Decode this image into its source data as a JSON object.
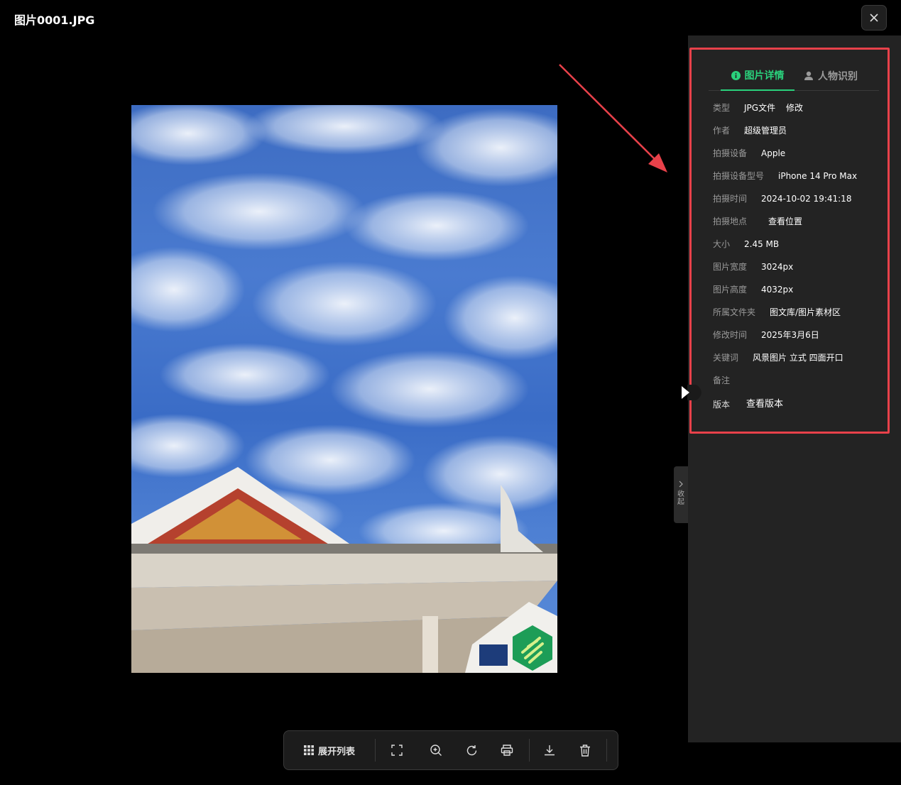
{
  "window": {
    "title": "图片0001.JPG"
  },
  "tabs": [
    {
      "label": "图片详情",
      "active": true
    },
    {
      "label": "人物识别",
      "active": false
    }
  ],
  "details": {
    "type_label": "类型",
    "type_value": "JPG文件",
    "type_action": "修改",
    "author_label": "作者",
    "author_value": "超级管理员",
    "device_label": "拍摄设备",
    "device_value": "Apple",
    "model_label": "拍摄设备型号",
    "model_value": "iPhone 14 Pro Max",
    "time_label": "拍摄时间",
    "time_value": "2024-10-02 19:41:18",
    "location_label": "拍摄地点",
    "location_value": "查看位置",
    "size_label": "大小",
    "size_value": "2.45 MB",
    "width_label": "图片宽度",
    "width_value": "3024px",
    "height_label": "图片高度",
    "height_value": "4032px",
    "folder_label": "所属文件夹",
    "folder_value": "图文库/图片素材区",
    "modified_label": "修改时间",
    "modified_value": "2025年3月6日",
    "keywords_label": "关键词",
    "keywords_value": "风景图片 立式 四面开口",
    "notes_label": "备注",
    "version_label": "版本",
    "version_value": "查看版本"
  },
  "collapse": {
    "label_1": "收",
    "label_2": "起"
  },
  "toolbar": {
    "expand_list_label": "展开列表"
  },
  "colors": {
    "accent": "#2ad17c",
    "highlight": "#e8414a",
    "panel_bg": "#232323"
  }
}
